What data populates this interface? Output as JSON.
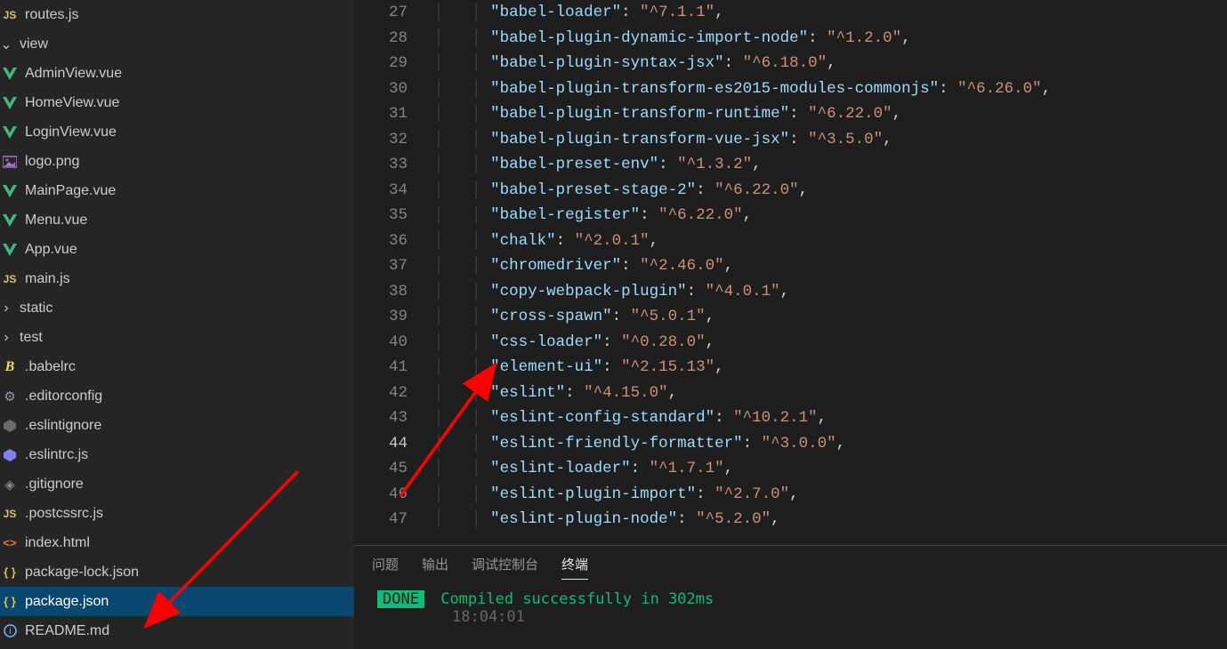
{
  "explorer": {
    "items": [
      {
        "indent": "ind3",
        "icon": "js",
        "label": "routes.js",
        "name": "file-routes-js"
      },
      {
        "indent": "ind2",
        "icon": "chev-open",
        "label": "view",
        "name": "folder-view",
        "folder": true
      },
      {
        "indent": "ind3",
        "icon": "vue",
        "label": "AdminView.vue",
        "name": "file-adminview"
      },
      {
        "indent": "ind3",
        "icon": "vue",
        "label": "HomeView.vue",
        "name": "file-homeview"
      },
      {
        "indent": "ind3",
        "icon": "vue",
        "label": "LoginView.vue",
        "name": "file-loginview"
      },
      {
        "indent": "ind3",
        "icon": "img",
        "label": "logo.png",
        "name": "file-logo-png"
      },
      {
        "indent": "ind3",
        "icon": "vue",
        "label": "MainPage.vue",
        "name": "file-mainpage"
      },
      {
        "indent": "ind3",
        "icon": "vue",
        "label": "Menu.vue",
        "name": "file-menu"
      },
      {
        "indent": "ind2",
        "icon": "vue",
        "label": "App.vue",
        "name": "file-app-vue"
      },
      {
        "indent": "ind2",
        "icon": "js",
        "label": "main.js",
        "name": "file-main-js"
      },
      {
        "indent": "ind1",
        "icon": "chev",
        "label": "static",
        "name": "folder-static",
        "folder": true,
        "pad": "i40"
      },
      {
        "indent": "ind1",
        "icon": "chev",
        "label": "test",
        "name": "folder-test",
        "folder": true,
        "pad": "i40"
      },
      {
        "indent": "ind1",
        "icon": "babel",
        "label": ".babelrc",
        "name": "file-babelrc",
        "pad": "i58"
      },
      {
        "indent": "ind1",
        "icon": "gear",
        "label": ".editorconfig",
        "name": "file-editorconfig",
        "pad": "i58"
      },
      {
        "indent": "ind1",
        "icon": "eslint-ign",
        "label": ".eslintignore",
        "name": "file-eslintignore",
        "pad": "i58"
      },
      {
        "indent": "ind1",
        "icon": "eslint",
        "label": ".eslintrc.js",
        "name": "file-eslintrc",
        "pad": "i58"
      },
      {
        "indent": "ind1",
        "icon": "git",
        "label": ".gitignore",
        "name": "file-gitignore",
        "pad": "i58"
      },
      {
        "indent": "ind1",
        "icon": "js",
        "label": ".postcssrc.js",
        "name": "file-postcssrc",
        "pad": "i58"
      },
      {
        "indent": "ind1",
        "icon": "html",
        "label": "index.html",
        "name": "file-index-html",
        "pad": "i58"
      },
      {
        "indent": "ind1",
        "icon": "json",
        "label": "package-lock.json",
        "name": "file-package-lock",
        "pad": "i58"
      },
      {
        "indent": "ind1",
        "icon": "json",
        "label": "package.json",
        "name": "file-package-json",
        "selected": true,
        "pad": "i58"
      },
      {
        "indent": "ind1",
        "icon": "info",
        "label": "README.md",
        "name": "file-readme",
        "pad": "i58"
      }
    ]
  },
  "code": {
    "first_line_no": 27,
    "cursor_line_no": 44,
    "lines": [
      {
        "k": "babel-loader",
        "v": "^7.1.1"
      },
      {
        "k": "babel-plugin-dynamic-import-node",
        "v": "^1.2.0"
      },
      {
        "k": "babel-plugin-syntax-jsx",
        "v": "^6.18.0"
      },
      {
        "k": "babel-plugin-transform-es2015-modules-commonjs",
        "v": "^6.26.0"
      },
      {
        "k": "babel-plugin-transform-runtime",
        "v": "^6.22.0"
      },
      {
        "k": "babel-plugin-transform-vue-jsx",
        "v": "^3.5.0"
      },
      {
        "k": "babel-preset-env",
        "v": "^1.3.2"
      },
      {
        "k": "babel-preset-stage-2",
        "v": "^6.22.0"
      },
      {
        "k": "babel-register",
        "v": "^6.22.0"
      },
      {
        "k": "chalk",
        "v": "^2.0.1"
      },
      {
        "k": "chromedriver",
        "v": "^2.46.0"
      },
      {
        "k": "copy-webpack-plugin",
        "v": "^4.0.1"
      },
      {
        "k": "cross-spawn",
        "v": "^5.0.1"
      },
      {
        "k": "css-loader",
        "v": "^0.28.0"
      },
      {
        "k": "element-ui",
        "v": "^2.15.13"
      },
      {
        "k": "eslint",
        "v": "^4.15.0"
      },
      {
        "k": "eslint-config-standard",
        "v": "^10.2.1"
      },
      {
        "k": "eslint-friendly-formatter",
        "v": "^3.0.0"
      },
      {
        "k": "eslint-loader",
        "v": "^1.7.1"
      },
      {
        "k": "eslint-plugin-import",
        "v": "^2.7.0"
      },
      {
        "k": "eslint-plugin-node",
        "v": "^5.2.0"
      }
    ]
  },
  "panel": {
    "tabs": {
      "problems": "问题",
      "output": "输出",
      "debug": "调试控制台",
      "terminal": "终端"
    },
    "done_badge": " DONE ",
    "done_msg": "Compiled successfully in 302ms",
    "time": "18:04:01"
  }
}
